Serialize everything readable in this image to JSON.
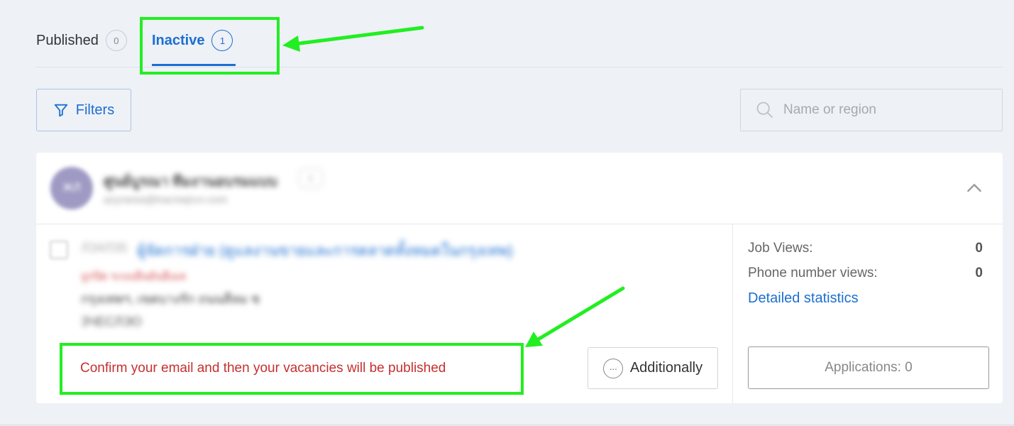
{
  "tabs": [
    {
      "label": "Published",
      "count": "0"
    },
    {
      "label": "Inactive",
      "count": "1"
    }
  ],
  "toolbar": {
    "filters_label": "Filters",
    "search_placeholder": "Name or region"
  },
  "card": {
    "company": {
      "avatar_text": "ЖЛ",
      "name": "ศูนย์บูรณา ทีมงานอบรมแบบ",
      "count": "1",
      "email": "azyrarea@tracnwjrcn.com"
    },
    "vacancy": {
      "id_label": "ЛЗ4ЛЗ5",
      "title": "ผู้จัดการฝ่าย (ดูแลงานขายและการตลาดทั้งหมดในกรุงเทพ)",
      "status": "ถูกปิด ระบบยืนยันอีเมล",
      "location": "กรุงเทพฯ, เขตบางรัก ถนนสีลม ช",
      "salary": "ЗЧЕСЛЭО"
    },
    "confirm_message": "Confirm your email and then your vacancies will be published",
    "additionally_label": "Additionally",
    "stats": {
      "job_views_label": "Job Views:",
      "job_views_value": "0",
      "phone_views_label": "Phone number views:",
      "phone_views_value": "0",
      "detailed_link": "Detailed statistics",
      "applications_label": "Applications: 0"
    }
  },
  "colors": {
    "accent": "#1c6fd0",
    "warning_text": "#c62f2f",
    "annotation_green": "#22ee22",
    "background": "#eef1f6"
  },
  "icons": [
    "filter-icon",
    "search-icon",
    "chevron-up-icon",
    "more-horizontal-icon"
  ]
}
